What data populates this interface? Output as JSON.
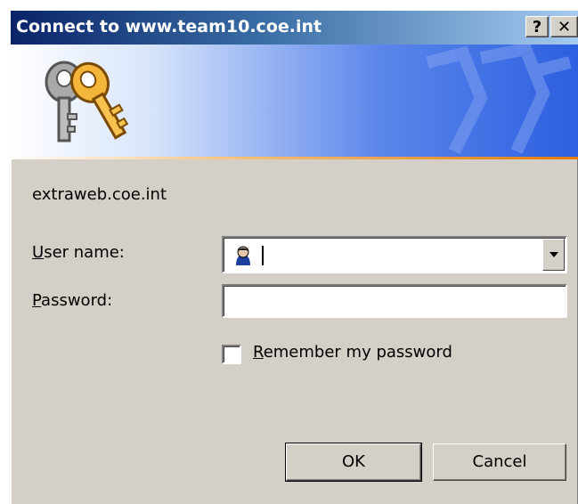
{
  "window": {
    "title": "Connect to www.team10.coe.int",
    "help_button": "?",
    "close_button": "✕"
  },
  "banner": {
    "icon": "keys-icon",
    "watermark_icon": "keys-watermark-icon"
  },
  "dialog": {
    "site": "extraweb.coe.int",
    "username": {
      "label_mnemonic": "U",
      "label_rest": "ser name:",
      "value": "",
      "icon": "user-icon",
      "dropdown_icon": "chevron-down-icon"
    },
    "password": {
      "label_mnemonic": "P",
      "label_rest": "assword:",
      "value": ""
    },
    "remember": {
      "label_mnemonic": "R",
      "label_rest": "emember my password",
      "checked": false
    },
    "ok_label": "OK",
    "cancel_label": "Cancel"
  },
  "colors": {
    "titlebar_start": "#0a246a",
    "titlebar_end": "#a6caf0",
    "dialog_bg": "#d4d0c8",
    "banner_accent": "#e07a10"
  }
}
